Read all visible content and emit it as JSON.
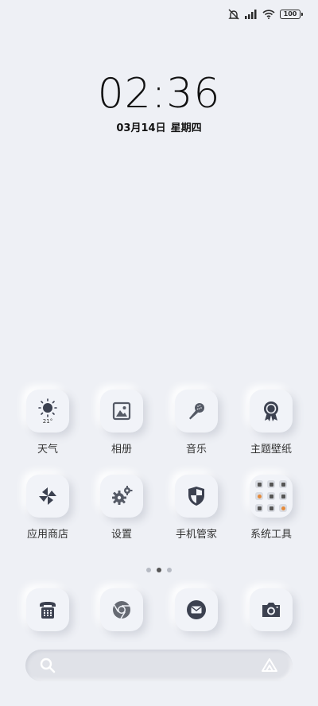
{
  "status_bar": {
    "battery": "100"
  },
  "lockscreen": {
    "time": "02:36",
    "date": "03月14日",
    "weekday": "星期四"
  },
  "weather_widget": {
    "temperature": "21°"
  },
  "apps": [
    {
      "label": "天气",
      "icon": "weather-sun-icon"
    },
    {
      "label": "相册",
      "icon": "gallery-icon"
    },
    {
      "label": "音乐",
      "icon": "microphone-icon"
    },
    {
      "label": "主题壁纸",
      "icon": "theme-badge-icon"
    },
    {
      "label": "应用商店",
      "icon": "app-store-pinwheel-icon"
    },
    {
      "label": "设置",
      "icon": "settings-gears-icon"
    },
    {
      "label": "手机管家",
      "icon": "security-shield-icon"
    },
    {
      "label": "系统工具",
      "icon": "folder-grid-icon"
    }
  ],
  "dock": [
    {
      "name": "phone",
      "icon": "phone-icon"
    },
    {
      "name": "browser",
      "icon": "browser-icon"
    },
    {
      "name": "messages",
      "icon": "message-icon"
    },
    {
      "name": "camera",
      "icon": "camera-icon"
    }
  ],
  "pager": {
    "pages": 3,
    "active": 2
  },
  "colors": {
    "background": "#eef0f5",
    "icon_gray": "#666a73",
    "icon_dark": "#3c4150"
  }
}
